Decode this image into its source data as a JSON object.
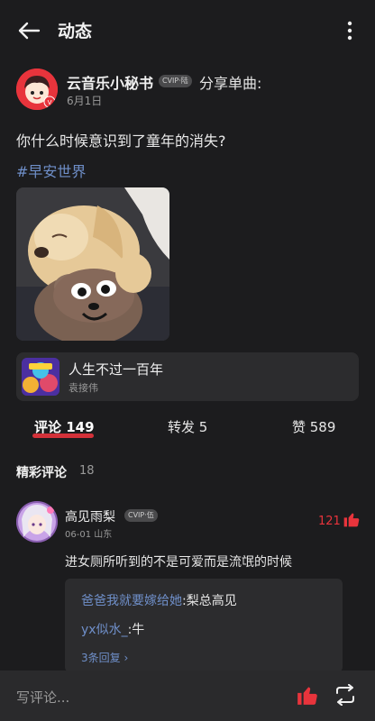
{
  "header": {
    "title": "动态"
  },
  "post": {
    "author": "云音乐小秘书",
    "vip_badge": "CVIP·陆",
    "action": "分享单曲:",
    "date": "6月1日",
    "text": "你什么时候意识到了童年的消失?",
    "tag": "#早安世界",
    "song": {
      "title": "人生不过一百年",
      "artist": "袁接伟"
    }
  },
  "stats": {
    "comments": "评论 149",
    "reposts": "转发 5",
    "likes": "赞 589"
  },
  "comments_section": {
    "title": "精彩评论",
    "count": "18",
    "comment": {
      "user": "高见雨梨",
      "vip_badge": "CVIP·伍",
      "meta": "06-01 山东",
      "like_count": "121",
      "text": "进女厕所听到的不是可爱而是流氓的时候",
      "replies": [
        {
          "user": "爸爸我就要嫁给她",
          "text": ":梨总高见"
        },
        {
          "user": "yx似水_",
          "text": ":牛"
        }
      ],
      "more_replies": "3条回复 ›"
    }
  },
  "bottom_bar": {
    "comment_placeholder": "写评论..."
  },
  "colors": {
    "accent_red": "#e8343c",
    "link_blue": "#6f8fc9",
    "background": "#1c1c1e"
  },
  "icons": [
    "back-arrow-icon",
    "more-vertical-icon",
    "thumbs-up-icon",
    "repost-icon"
  ]
}
